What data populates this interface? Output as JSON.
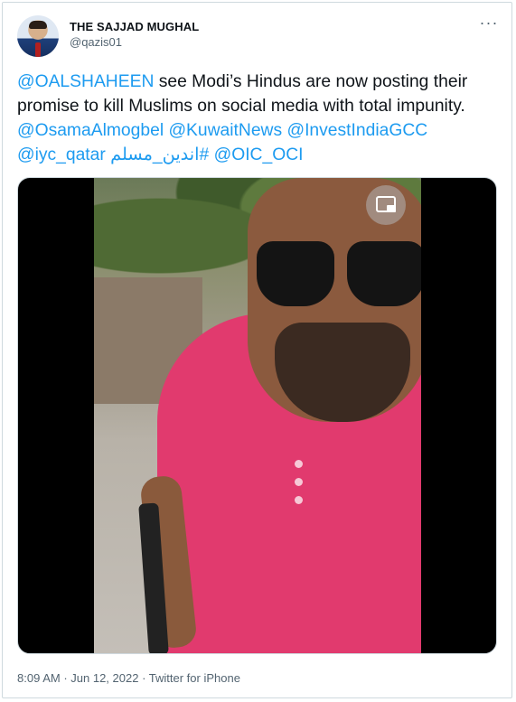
{
  "author": {
    "display_name": "THE SAJJAD MUGHAL",
    "handle": "@qazis01"
  },
  "more_icon": "more-dots-icon",
  "tweet": {
    "segments": [
      {
        "text": "@OALSHAHEEN",
        "kind": "mention"
      },
      {
        "text": " see Modi’s Hindus are now posting their promise to kill Muslims on social media with total impunity. ",
        "kind": "text"
      },
      {
        "text": "@OsamaAlmogbel",
        "kind": "mention"
      },
      {
        "text": " ",
        "kind": "text"
      },
      {
        "text": "@KuwaitNews",
        "kind": "mention"
      },
      {
        "text": " ",
        "kind": "text"
      },
      {
        "text": "@InvestIndiaGCC",
        "kind": "mention"
      },
      {
        "text": " ",
        "kind": "text"
      },
      {
        "text": "@iyc_qatar",
        "kind": "mention"
      },
      {
        "text": " ",
        "kind": "text"
      },
      {
        "text": "#اندين_مسلم",
        "kind": "hashtag"
      },
      {
        "text": " ",
        "kind": "text"
      },
      {
        "text": "@OIC_OCI",
        "kind": "mention"
      }
    ]
  },
  "media": {
    "type": "video",
    "pip_icon": "picture-in-picture-icon"
  },
  "meta": {
    "time": "8:09 AM",
    "sep1": " · ",
    "date": "Jun 12, 2022",
    "sep2": " · ",
    "source": "Twitter for iPhone"
  },
  "colors": {
    "link": "#1d9bf0",
    "text": "#0f1419",
    "secondary": "#536471",
    "border": "#cfd9de"
  }
}
